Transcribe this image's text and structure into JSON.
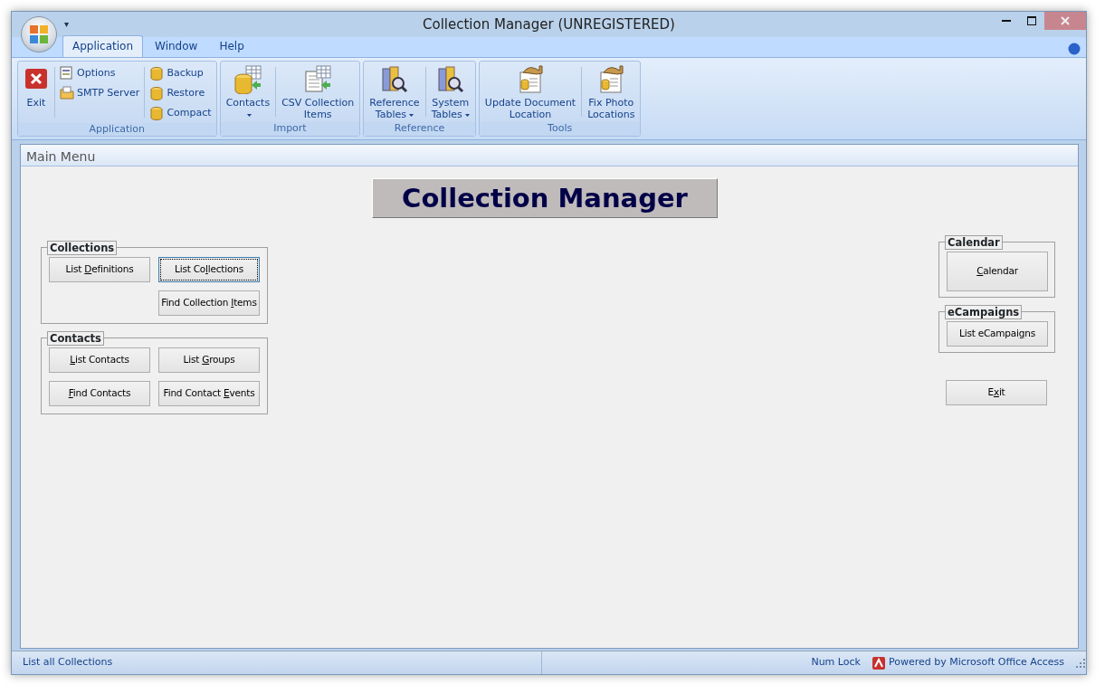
{
  "window": {
    "title": "Collection Manager (UNREGISTERED)",
    "quick_access": "▾"
  },
  "tabs": [
    {
      "label": "Application",
      "selected": true
    },
    {
      "label": "Window",
      "selected": false
    },
    {
      "label": "Help",
      "selected": false
    }
  ],
  "ribbon": [
    {
      "label": "Application",
      "items": [
        {
          "kind": "large",
          "label": [
            "Exit"
          ],
          "dropdown": false
        },
        {
          "kind": "stack",
          "items": [
            "Options",
            "SMTP Server"
          ]
        },
        {
          "kind": "stack",
          "items": [
            "Backup",
            "Restore",
            "Compact"
          ]
        }
      ]
    },
    {
      "label": "Import",
      "items": [
        {
          "kind": "large",
          "label": [
            "Contacts"
          ],
          "dropdown": true
        },
        {
          "kind": "large",
          "label": [
            "CSV Collection",
            "Items"
          ],
          "dropdown": false
        }
      ]
    },
    {
      "label": "Reference",
      "items": [
        {
          "kind": "large",
          "label": [
            "Reference",
            "Tables"
          ],
          "dropdown": true
        },
        {
          "kind": "large",
          "label": [
            "System",
            "Tables"
          ],
          "dropdown": true
        }
      ]
    },
    {
      "label": "Tools",
      "items": [
        {
          "kind": "large",
          "label": [
            "Update Document",
            "Location"
          ],
          "dropdown": false
        },
        {
          "kind": "large",
          "label": [
            "Fix Photo",
            "Locations"
          ],
          "dropdown": false
        }
      ]
    }
  ],
  "form": {
    "title": "Main Menu",
    "heading": "Collection Manager",
    "left_groups": [
      {
        "label": "Collections",
        "columns": [
          [
            {
              "label": {
                "before": "List ",
                "key": "D",
                "after": "efinitions"
              },
              "focused": false
            }
          ],
          [
            {
              "label": {
                "before": "List Co",
                "key": "l",
                "after": "lections"
              },
              "focused": true
            },
            {
              "label": {
                "before": "Find Collection ",
                "key": "I",
                "after": "tems"
              },
              "focused": false
            }
          ]
        ]
      },
      {
        "label": "Contacts",
        "columns": [
          [
            {
              "label": {
                "key": "L",
                "after": "ist Contacts"
              },
              "focused": false
            },
            {
              "label": {
                "key": "F",
                "after": "ind Contacts"
              },
              "focused": false
            }
          ],
          [
            {
              "label": {
                "before": "List ",
                "key": "G",
                "after": "roups"
              },
              "focused": false
            },
            {
              "label": {
                "before": "Find Contact ",
                "key": "E",
                "after": "vents"
              },
              "focused": false
            }
          ]
        ]
      }
    ],
    "right_groups": [
      {
        "label": "Calendar",
        "buttons": [
          {
            "label": {
              "key": "C",
              "after": "alendar"
            },
            "focused": false
          }
        ]
      },
      {
        "label": "eCampaigns",
        "buttons": [
          {
            "label": {
              "before": "List eCampai",
              "key": "g",
              "after": "ns"
            },
            "focused": false
          }
        ]
      }
    ],
    "exit_button": {
      "label": {
        "before": "E",
        "key": "x",
        "after": "it"
      },
      "focused": false
    }
  },
  "status_bar": {
    "message": "List all Collections",
    "num_lock": "Num Lock",
    "powered_by": "Powered by Microsoft Office Access"
  }
}
